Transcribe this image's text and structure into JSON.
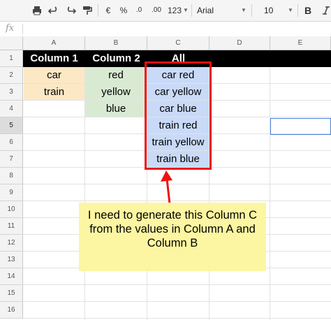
{
  "toolbar": {
    "currency": "€",
    "percent": "%",
    "decrease_decimal": ".0",
    "increase_decimal": ".00",
    "number_format": "123",
    "font": "Arial",
    "font_size": "10",
    "bold": "B"
  },
  "formula_bar": {
    "fx": "fx"
  },
  "columns": [
    "A",
    "B",
    "C",
    "D",
    "E"
  ],
  "rows": [
    "1",
    "2",
    "3",
    "4",
    "5",
    "6",
    "7",
    "8",
    "9",
    "10",
    "11",
    "12",
    "13",
    "14",
    "15",
    "16"
  ],
  "cells": {
    "A1": "Column 1",
    "B1": "Column 2",
    "C1": "All",
    "A2": "car",
    "B2": "red",
    "C2": "car red",
    "A3": "train",
    "B3": "yellow",
    "C3": "car yellow",
    "B4": "blue",
    "C4": "car blue",
    "C5": "train red",
    "C6": "train yellow",
    "C7": "train blue"
  },
  "annotation": {
    "note": "I need to generate this Column C from the values in Column A and Column B"
  },
  "colors": {
    "column_a_fill": "#fce8c4",
    "column_b_fill": "#d9ead3",
    "column_c_fill": "#c9daf8",
    "highlight_border": "#ee1111",
    "note_fill": "#fcf5a1",
    "selection": "#4a7edc"
  },
  "selected_row": "5"
}
